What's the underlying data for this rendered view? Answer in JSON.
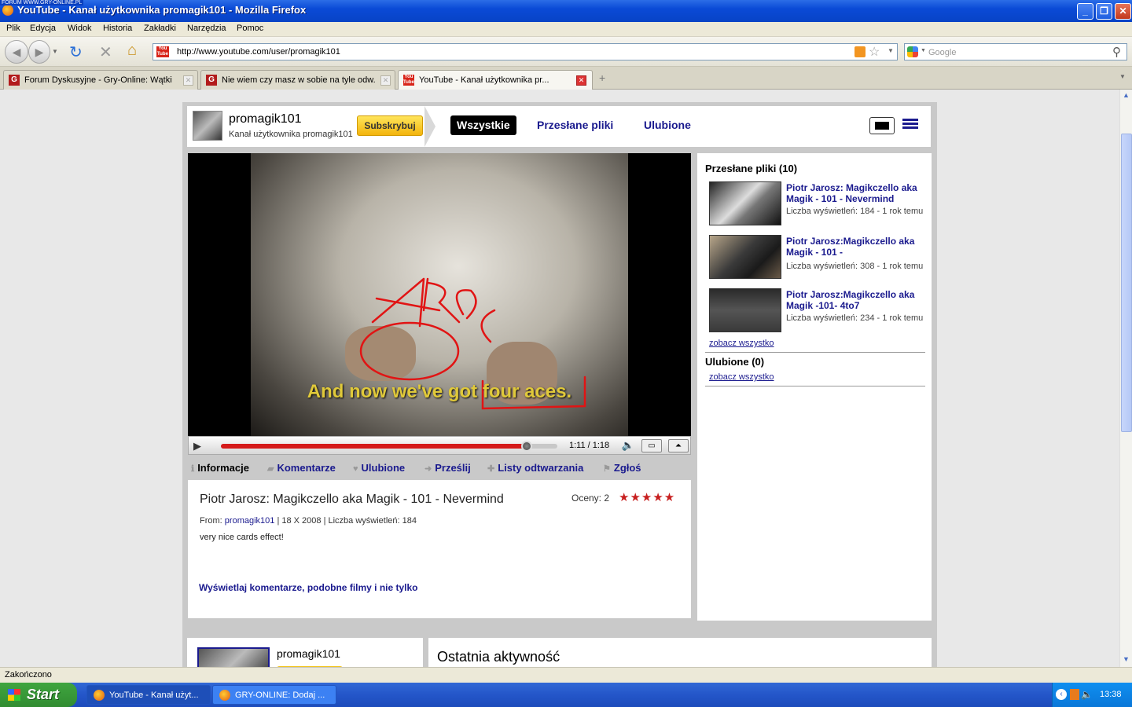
{
  "window": {
    "title": "YouTube - Kanał użytkownika promagik101 - Mozilla Firefox",
    "tag": "FORUM WWW.GRY-ONLINE.PL"
  },
  "menu": [
    "Plik",
    "Edycja",
    "Widok",
    "Historia",
    "Zakładki",
    "Narzędzia",
    "Pomoc"
  ],
  "address": {
    "url": "http://www.youtube.com/user/promagik101",
    "favicon_text": "You Tube"
  },
  "search": {
    "placeholder": "Google"
  },
  "tabs": [
    {
      "label": "Forum Dyskusyjne - Gry-Online: Wątki"
    },
    {
      "label": "Nie wiem czy masz w sobie na tyle odw..."
    },
    {
      "label": "YouTube - Kanał użytkownika pr..."
    }
  ],
  "channel": {
    "name": "promagik101",
    "subtitle": "Kanał użytkownika promagik101",
    "subscribe": "Subskrybuj",
    "nav": [
      "Wszystkie",
      "Przesłane pliki",
      "Ulubione"
    ]
  },
  "player": {
    "caption": "And now we've got four aces.",
    "time": "1:11 / 1:18",
    "progress": 0.91
  },
  "video_tabs": [
    "Informacje",
    "Komentarze",
    "Ulubione",
    "Prześlij",
    "Listy odtwarzania",
    "Zgłoś"
  ],
  "info": {
    "title": "Piotr Jarosz: Magikczello aka Magik - 101 - Nevermind",
    "rating_label": "Oceny: 2",
    "stars": "★★★★★",
    "from_label": "From:",
    "from_user": "promagik101",
    "meta_rest": "| 18 X 2008 | Liczba wyświetleń: 184",
    "description": "very nice cards effect!",
    "more": "Wyświetlaj komentarze, podobne filmy i nie tylko"
  },
  "sidebar": {
    "uploads_heading": "Przesłane pliki (10)",
    "videos": [
      {
        "title": "Piotr Jarosz: Magikczello aka Magik - 101 - Nevermind",
        "meta": "Liczba wyświetleń: 184 - 1 rok temu"
      },
      {
        "title": "Piotr Jarosz:Magikczello aka Magik - 101 -",
        "meta": "Liczba wyświetleń: 308 - 1 rok temu"
      },
      {
        "title": "Piotr Jarosz:Magikczello aka Magik -101- 4to7",
        "meta": "Liczba wyświetleń: 234 - 1 rok temu"
      }
    ],
    "see_all": "zobacz wszystko",
    "favorites_heading": "Ulubione (0)"
  },
  "lower": {
    "name": "promagik101",
    "activity": "Ostatnia aktywność"
  },
  "status": "Zakończono",
  "taskbar": {
    "start": "Start",
    "tasks": [
      "YouTube - Kanał użyt...",
      "GRY-ONLINE: Dodaj ..."
    ],
    "clock": "13:38"
  }
}
